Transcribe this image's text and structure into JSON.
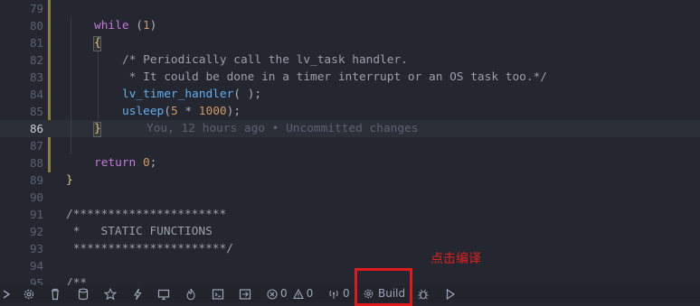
{
  "editor": {
    "line_numbers": [
      "79",
      "80",
      "81",
      "82",
      "83",
      "84",
      "85",
      "86",
      "87",
      "88",
      "89",
      "90",
      "91",
      "92",
      "93",
      "94",
      "95"
    ],
    "code": {
      "l80_kw": "while",
      "l80_rest": " (",
      "l80_num": "1",
      "l80_end": ")",
      "l81": "{",
      "l82": "/* Periodically call the lv_task handler.",
      "l83": " * It could be done in a timer interrupt or an OS task too.*/",
      "l84_fn": "lv_timer_handler",
      "l84_rest": "( );",
      "l85_fn": "usleep",
      "l85_a": "(",
      "l85_n1": "5",
      "l85_b": " * ",
      "l85_n2": "1000",
      "l85_c": ");",
      "l86": "}",
      "l86_blame": "You, 12 hours ago • Uncommitted changes",
      "l88_kw": "return",
      "l88_sp": " ",
      "l88_num": "0",
      "l88_end": ";",
      "l89": "}",
      "l91": "/**********************",
      "l92": " *   STATIC FUNCTIONS",
      "l93": " **********************/",
      "l95": "/**"
    }
  },
  "statusbar": {
    "errors": "0",
    "warnings": "0",
    "ports": "0",
    "build_label": "Build"
  },
  "annotation": {
    "text": "点击编译"
  },
  "colors": {
    "background": "#24272f",
    "annotation_red": "#e01b1b",
    "keyword": "#c678dd",
    "function": "#61afef",
    "number": "#d19a66"
  }
}
